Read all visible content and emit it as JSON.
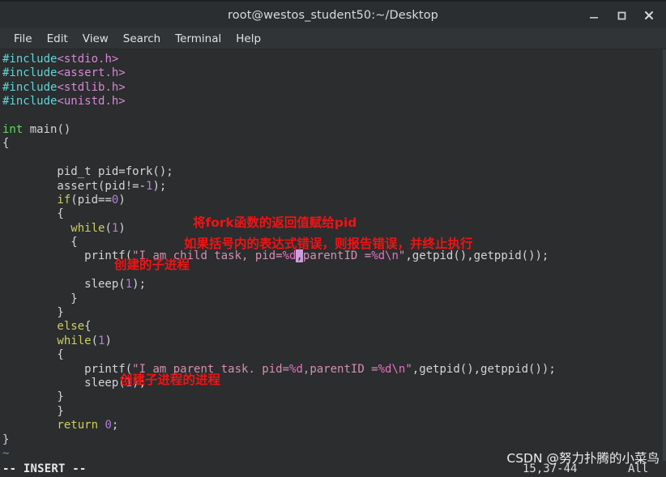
{
  "window": {
    "title": "root@westos_student50:~/Desktop",
    "controls": [
      {
        "name": "minimize",
        "glyph": "_"
      },
      {
        "name": "maximize",
        "glyph": "□"
      },
      {
        "name": "close",
        "glyph": "✕"
      }
    ]
  },
  "menubar": {
    "items": [
      {
        "label": "File"
      },
      {
        "label": "Edit"
      },
      {
        "label": "View"
      },
      {
        "label": "Search"
      },
      {
        "label": "Terminal"
      },
      {
        "label": "Help"
      }
    ]
  },
  "code": {
    "line01_include_kw": "#include",
    "line01_header": "<stdio.h>",
    "line02_include_kw": "#include",
    "line02_header": "<assert.h>",
    "line03_include_kw": "#include",
    "line03_header": "<stdlib.h>",
    "line04_include_kw": "#include",
    "line04_header": "<unistd.h>",
    "line06_type": "int",
    "line06_rest": " main()",
    "line07_brace": "{",
    "line09_decl": "        pid_t pid=fork();",
    "line10_assert_a": "        assert(pid!=-",
    "line10_assert_num": "1",
    "line10_assert_b": ");",
    "line11_if_kw": "        if",
    "line11_if_a": "(pid==",
    "line11_if_num": "0",
    "line11_if_b": ")",
    "line12_brace": "        {",
    "line13_while_kw": "          while",
    "line13_while_a": "(",
    "line13_while_num": "1",
    "line13_while_b": ")",
    "line14_brace": "          {",
    "line15_printf_head": "            printf(",
    "line15_str_open": "\"",
    "line15_str_a": "I am child task, pid=",
    "line15_fmt_a": "%d",
    "line15_cursor": ",",
    "line15_str_b": "parentID =",
    "line15_fmt_b": "%d\\n",
    "line15_str_close": "\"",
    "line15_tail": ",getpid(),getppid());",
    "line17_sleep": "            sleep(",
    "line17_num": "1",
    "line17_tail": ");",
    "line18_brace": "          }",
    "line19_brace": "        }",
    "line20_else_kw": "        else",
    "line20_else_brace": "{",
    "line21_while_kw": "        while",
    "line21_while_a": "(",
    "line21_while_num": "1",
    "line21_while_b": ")",
    "line22_brace": "        {",
    "line23_printf_head": "            printf(",
    "line23_str_open": "\"",
    "line23_str_a": "I am parent task. pid=",
    "line23_fmt_a": "%d",
    "line23_str_b": ",parentID =",
    "line23_fmt_b": "%d\\n",
    "line23_str_close": "\"",
    "line23_tail": ",getpid(),getppid());",
    "line24_sleep": "            sleep(",
    "line24_num": "1",
    "line24_tail": ");",
    "line25_brace": "        }",
    "line26_brace": "        }",
    "line27_return_kw": "        return ",
    "line27_return_num": "0",
    "line27_return_semi": ";",
    "line28_brace": "}",
    "line29_tilde": "~"
  },
  "annotations": {
    "assign_fork": "将fork函数的返回值赋给pid",
    "assert_explain": "如果括号内的表达式错误，则报告错误，并终止执行",
    "child_process": "创建的子进程",
    "parent_process": "创建子进程的进程"
  },
  "statusline": {
    "mode": "-- INSERT --",
    "position": "15,37-44",
    "scroll": "All"
  },
  "watermark": {
    "text": "CSDN @努力扑腾的小菜鸟"
  },
  "colors": {
    "titlebar_bg": "#2b2e31",
    "menubar_bg": "#313436",
    "terminal_bg": "#2b2d2f",
    "annotation_red": "#f01414",
    "cursor": "#c9a0dc",
    "preproc_cyan": "#5fd7d7",
    "header_magenta": "#d787d7",
    "type_green": "#5fd75f",
    "keyword_yellow": "#cfcf5f",
    "number_purple": "#b57fd8",
    "string_pink": "#d490b0",
    "format_magenta": "#e86fc0"
  }
}
